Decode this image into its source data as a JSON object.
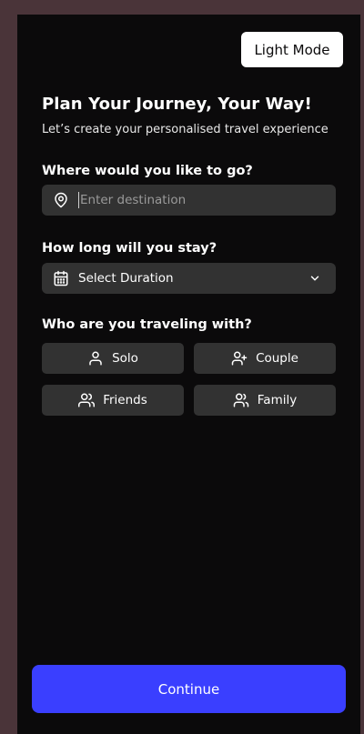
{
  "header": {
    "mode_toggle_label": "Light Mode"
  },
  "intro": {
    "title": "Plan Your Journey, Your Way!",
    "subtitle": "Let’s create your personalised travel experience"
  },
  "destination": {
    "question": "Where would you like to go?",
    "placeholder": "Enter destination",
    "value": "",
    "icon": "map-pin-icon"
  },
  "duration": {
    "question": "How long will you stay?",
    "selected": "Select Duration",
    "icon": "calendar-icon",
    "dropdown_icon": "chevron-down-icon"
  },
  "companions": {
    "question": "Who are you traveling with?",
    "options": [
      {
        "label": "Solo",
        "icon": "user-icon"
      },
      {
        "label": "Couple",
        "icon": "user-plus-icon"
      },
      {
        "label": "Friends",
        "icon": "users-icon"
      },
      {
        "label": "Family",
        "icon": "family-icon"
      }
    ]
  },
  "footer": {
    "continue_label": "Continue"
  },
  "colors": {
    "background": "#0b0a0b",
    "surface": "#323232",
    "accent": "#3a3fff",
    "outer": "#4a3439"
  }
}
